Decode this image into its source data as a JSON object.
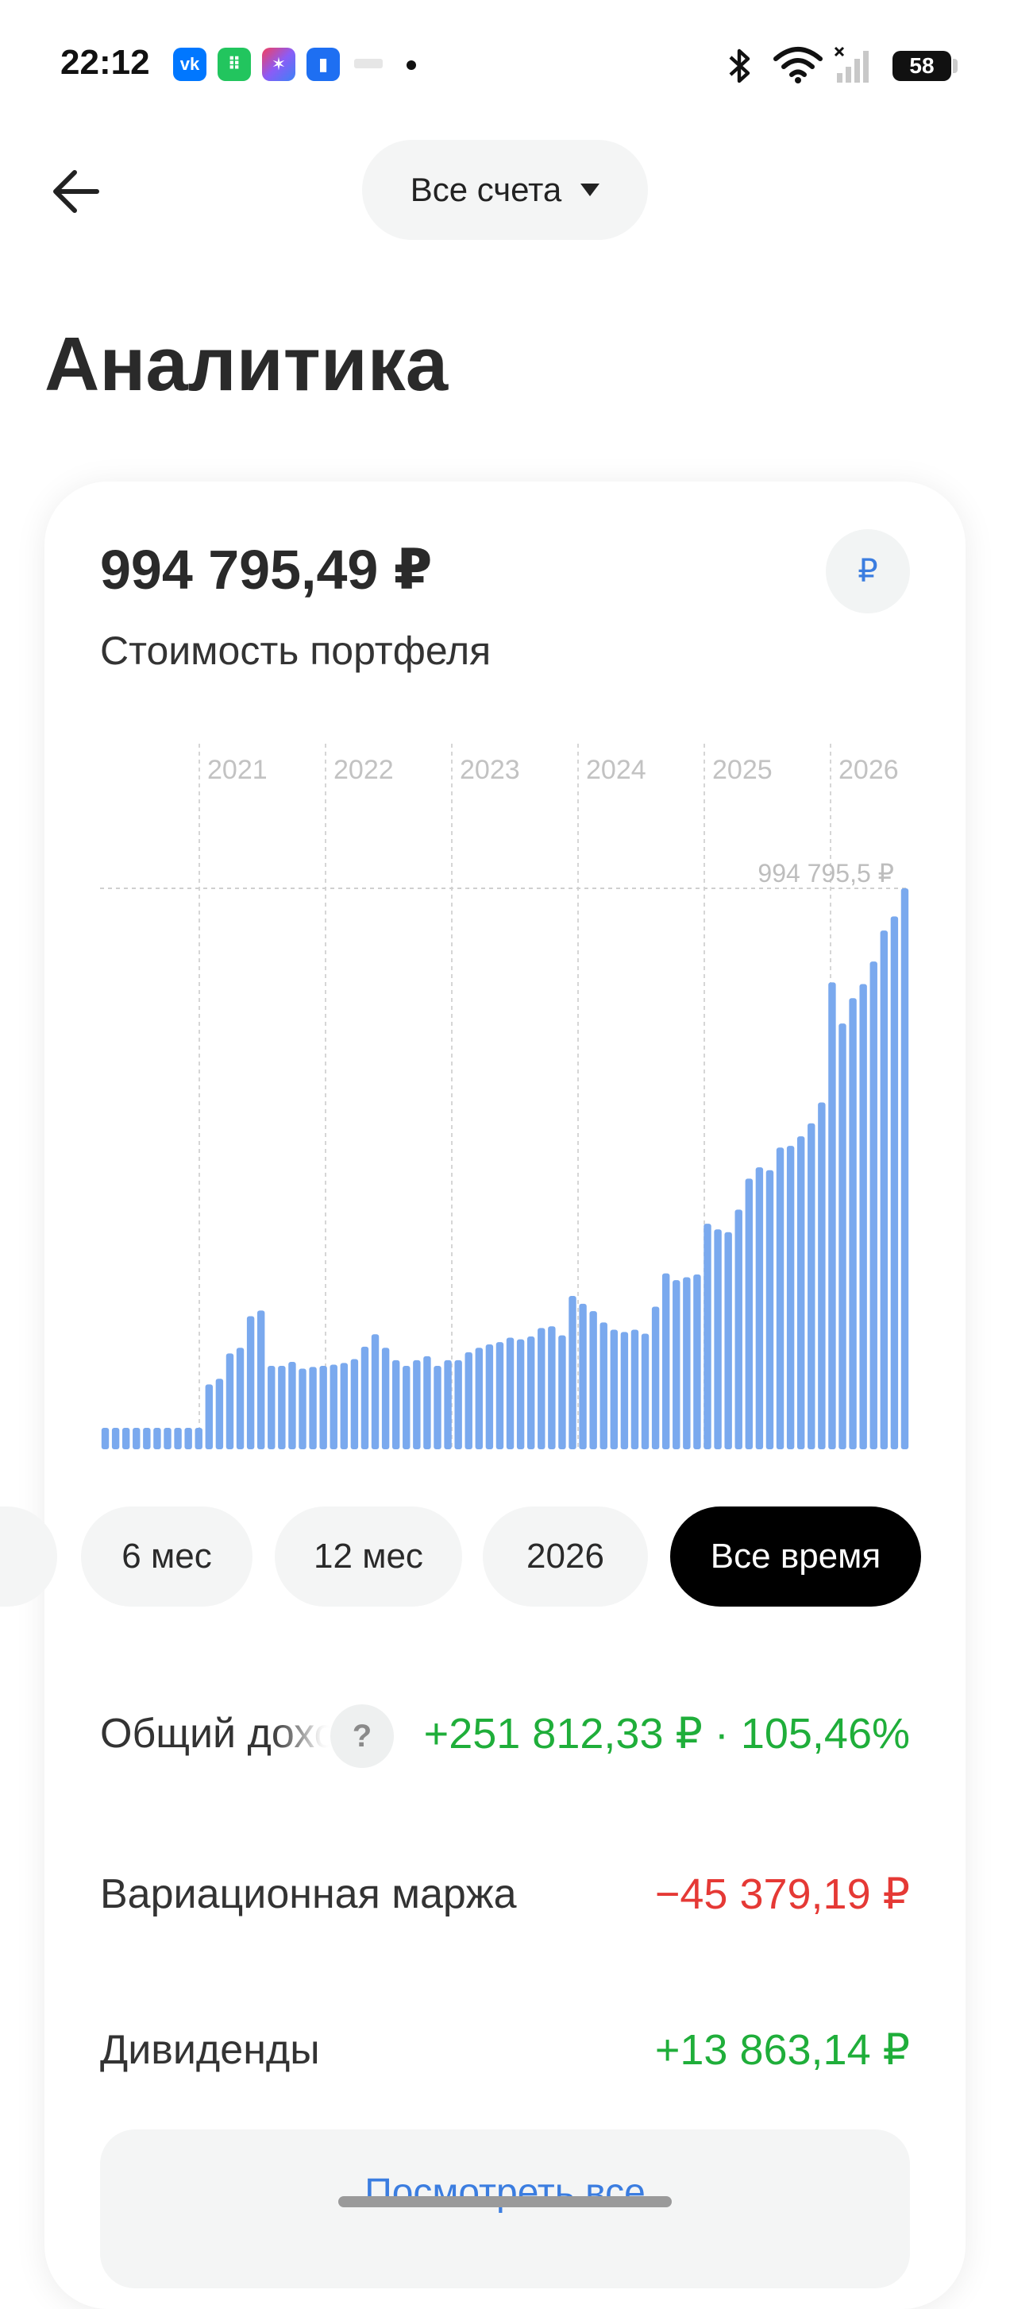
{
  "status_bar": {
    "time": "22:12",
    "apps": [
      {
        "icon": "vk-icon",
        "label": "vk",
        "color": "#0077ff"
      },
      {
        "icon": "green-app-icon",
        "label": "⠿",
        "color": "#22c55e"
      },
      {
        "icon": "star-app-icon",
        "label": "✶",
        "color": "#8b5cf6"
      },
      {
        "icon": "bank-app-icon",
        "label": "▮",
        "color": "#1e6ff2"
      }
    ],
    "battery": "58"
  },
  "header": {
    "account_selector": "Все счета",
    "page_title": "Аналитика"
  },
  "portfolio": {
    "value": "994 795,49 ₽",
    "caption": "Стоимость портфеля",
    "currency_button": "₽"
  },
  "chart_data": {
    "type": "bar",
    "x_tick_labels": [
      "2021",
      "2022",
      "2023",
      "2024",
      "2025",
      "2026"
    ],
    "max_label": "994 795,5 ₽",
    "ylim": [
      0,
      994795.5
    ],
    "bar_color": "#7aa9ee",
    "grid": "vertical dashed year separators",
    "values": [
      38000,
      38000,
      38000,
      38000,
      38000,
      38000,
      38000,
      38000,
      38000,
      38000,
      115000,
      125000,
      170000,
      180000,
      236000,
      246000,
      148000,
      148000,
      155000,
      143000,
      146000,
      148000,
      150000,
      153000,
      160000,
      182000,
      204000,
      180000,
      158000,
      148000,
      158000,
      165000,
      148000,
      158000,
      158000,
      172000,
      180000,
      186000,
      190000,
      198000,
      195000,
      200000,
      215000,
      218000,
      202000,
      272000,
      258000,
      245000,
      225000,
      212000,
      208000,
      212000,
      205000,
      253000,
      312000,
      300000,
      305000,
      310000,
      400000,
      390000,
      385000,
      425000,
      480000,
      500000,
      495000,
      535000,
      538000,
      555000,
      578000,
      615000,
      828000,
      755000,
      800000,
      825000,
      865000,
      920000,
      945000,
      994795
    ]
  },
  "periods": [
    {
      "label": "6 мес",
      "active": false
    },
    {
      "label": "12 мес",
      "active": false
    },
    {
      "label": "2026",
      "active": false
    },
    {
      "label": "Все время",
      "active": true
    }
  ],
  "rows": {
    "total_label": "Общий доход",
    "total_help": "?",
    "total_value": "+251 812,33 ₽ · 105,46%",
    "margin_label": "Вариационная маржа",
    "margin_value": "−45 379,19 ₽",
    "dividends_label": "Дивиденды",
    "dividends_value": "+13 863,14 ₽"
  },
  "view_all": "Посмотреть все"
}
